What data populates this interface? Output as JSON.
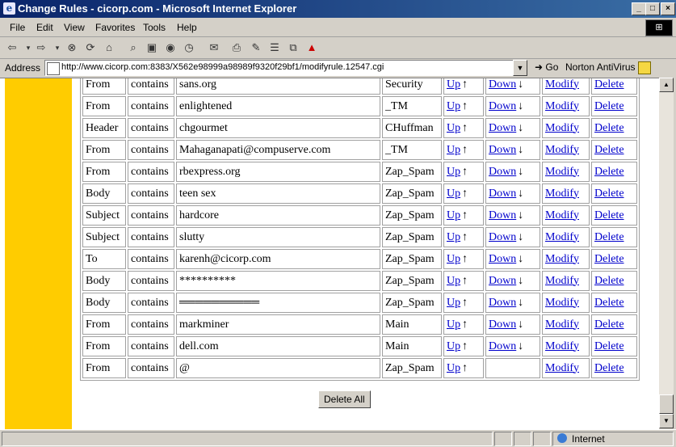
{
  "window": {
    "title": "Change Rules - cicorp.com - Microsoft Internet Explorer"
  },
  "menu": [
    "File",
    "Edit",
    "View",
    "Favorites",
    "Tools",
    "Help"
  ],
  "address": {
    "label": "Address",
    "url": "http://www.cicorp.com:8383/X562e98999a98989f9320f29bf1/modifyrule.12547.cgi",
    "go_label": "Go",
    "norton_label": "Norton AntiVirus"
  },
  "rules": [
    {
      "field": "From",
      "op": "contains",
      "value": "sans.org",
      "folder": "Security",
      "up": "Up",
      "down": "Down",
      "modify": "Modify",
      "delete": "Delete"
    },
    {
      "field": "From",
      "op": "contains",
      "value": "enlightened",
      "folder": "_TM",
      "up": "Up",
      "down": "Down",
      "modify": "Modify",
      "delete": "Delete"
    },
    {
      "field": "Header",
      "op": "contains",
      "value": "chgourmet",
      "folder": "CHuffman",
      "up": "Up",
      "down": "Down",
      "modify": "Modify",
      "delete": "Delete"
    },
    {
      "field": "From",
      "op": "contains",
      "value": "Mahaganapati@compuserve.com",
      "folder": "_TM",
      "up": "Up",
      "down": "Down",
      "modify": "Modify",
      "delete": "Delete"
    },
    {
      "field": "From",
      "op": "contains",
      "value": "rbexpress.org",
      "folder": "Zap_Spam",
      "up": "Up",
      "down": "Down",
      "modify": "Modify",
      "delete": "Delete"
    },
    {
      "field": "Body",
      "op": "contains",
      "value": "teen sex",
      "folder": "Zap_Spam",
      "up": "Up",
      "down": "Down",
      "modify": "Modify",
      "delete": "Delete"
    },
    {
      "field": "Subject",
      "op": "contains",
      "value": "hardcore",
      "folder": "Zap_Spam",
      "up": "Up",
      "down": "Down",
      "modify": "Modify",
      "delete": "Delete"
    },
    {
      "field": "Subject",
      "op": "contains",
      "value": "slutty",
      "folder": "Zap_Spam",
      "up": "Up",
      "down": "Down",
      "modify": "Modify",
      "delete": "Delete"
    },
    {
      "field": "To",
      "op": "contains",
      "value": "karenh@cicorp.com",
      "folder": "Zap_Spam",
      "up": "Up",
      "down": "Down",
      "modify": "Modify",
      "delete": "Delete"
    },
    {
      "field": "Body",
      "op": "contains",
      "value": "**********",
      "folder": "Zap_Spam",
      "up": "Up",
      "down": "Down",
      "modify": "Modify",
      "delete": "Delete"
    },
    {
      "field": "Body",
      "op": "contains",
      "value": "══════════",
      "folder": "Zap_Spam",
      "up": "Up",
      "down": "Down",
      "modify": "Modify",
      "delete": "Delete"
    },
    {
      "field": "From",
      "op": "contains",
      "value": "markminer",
      "folder": "Main",
      "up": "Up",
      "down": "Down",
      "modify": "Modify",
      "delete": "Delete"
    },
    {
      "field": "From",
      "op": "contains",
      "value": "dell.com",
      "folder": "Main",
      "up": "Up",
      "down": "Down",
      "modify": "Modify",
      "delete": "Delete"
    },
    {
      "field": "From",
      "op": "contains",
      "value": "@",
      "folder": "Zap_Spam",
      "up": "Up",
      "down": "",
      "modify": "Modify",
      "delete": "Delete"
    }
  ],
  "delete_all_label": "Delete All",
  "status": {
    "zone": "Internet"
  }
}
